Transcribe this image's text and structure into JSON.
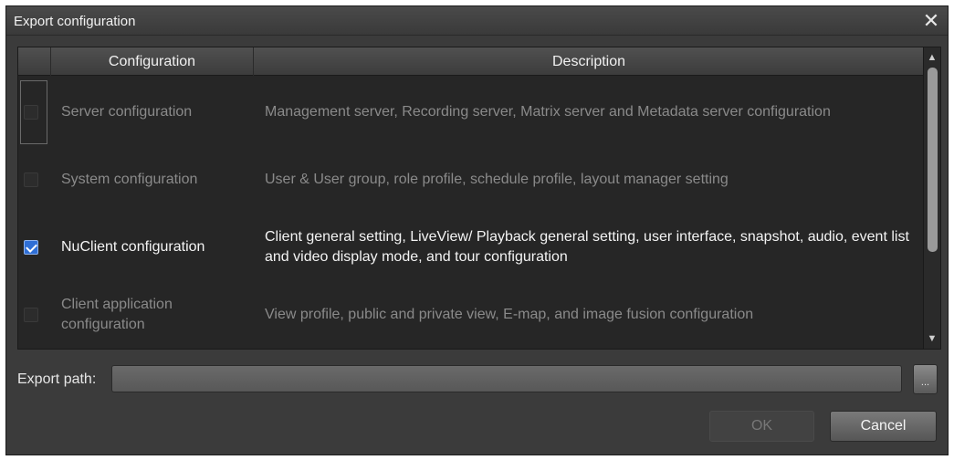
{
  "window": {
    "title": "Export configuration",
    "close_glyph": "✕"
  },
  "table": {
    "headers": {
      "configuration": "Configuration",
      "description": "Description"
    },
    "rows": [
      {
        "name": "Server configuration",
        "description": "Management server, Recording server, Matrix server and Metadata server configuration",
        "checked": false,
        "enabled": false
      },
      {
        "name": "System configuration",
        "description": "User & User group, role profile, schedule profile, layout manager setting",
        "checked": false,
        "enabled": false
      },
      {
        "name": "NuClient configuration",
        "description": "Client general setting, LiveView/ Playback general setting, user interface, snapshot, audio, event list and video display mode, and tour configuration",
        "checked": true,
        "enabled": true
      },
      {
        "name": "Client application configuration",
        "description": "View profile, public and private view, E-map, and image fusion configuration",
        "checked": false,
        "enabled": false
      }
    ],
    "scroll": {
      "up_icon": "▲",
      "down_icon": "▼"
    }
  },
  "export_path": {
    "label": "Export path:",
    "value": "",
    "browse_label": "..."
  },
  "buttons": {
    "ok": "OK",
    "cancel": "Cancel"
  },
  "colors": {
    "dialog_bg": "#3b3b3b",
    "grid_bg": "#262626",
    "checkbox_checked": "#2f6fd6",
    "dim_text": "#8a8a8a"
  }
}
